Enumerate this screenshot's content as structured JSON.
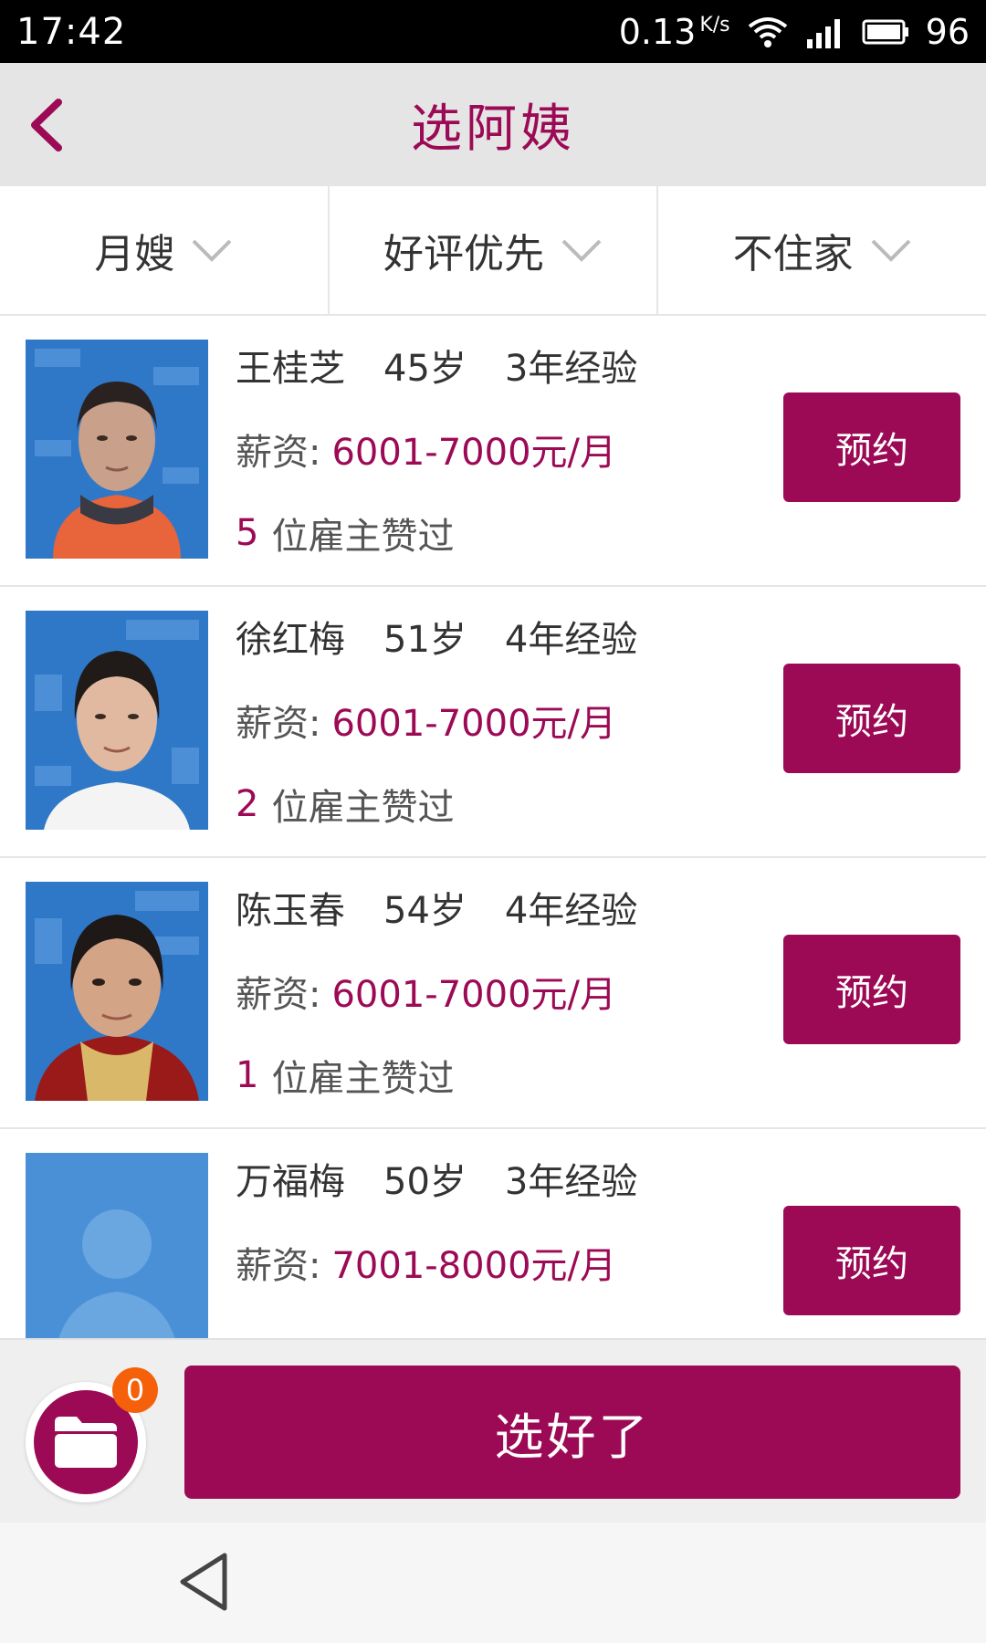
{
  "status_bar": {
    "time": "17:42",
    "speed": "0.13",
    "speed_unit": "K/s",
    "battery": "96",
    "icons": [
      "wifi-icon",
      "signal-icon",
      "battery-icon"
    ]
  },
  "header": {
    "title": "选阿姨",
    "back_icon": "chevron-left-icon",
    "accent_color": "#9c0a55"
  },
  "filters": [
    {
      "label": "月嫂",
      "icon": "chevron-down-icon"
    },
    {
      "label": "好评优先",
      "icon": "chevron-down-icon"
    },
    {
      "label": "不住家",
      "icon": "chevron-down-icon"
    }
  ],
  "nannies": [
    {
      "name": "王桂芝",
      "age": "45岁",
      "experience": "3年经验",
      "salary_label": "薪资:",
      "salary": "6001-7000元/月",
      "likes": "5",
      "likes_label": "位雇主赞过",
      "button": "预约"
    },
    {
      "name": "徐红梅",
      "age": "51岁",
      "experience": "4年经验",
      "salary_label": "薪资:",
      "salary": "6001-7000元/月",
      "likes": "2",
      "likes_label": "位雇主赞过",
      "button": "预约"
    },
    {
      "name": "陈玉春",
      "age": "54岁",
      "experience": "4年经验",
      "salary_label": "薪资:",
      "salary": "6001-7000元/月",
      "likes": "1",
      "likes_label": "位雇主赞过",
      "button": "预约"
    },
    {
      "name": "万福梅",
      "age": "50岁",
      "experience": "3年经验",
      "salary_label": "薪资:",
      "salary": "7001-8000元/月",
      "likes": "",
      "likes_label": "",
      "button": "预约"
    }
  ],
  "bottom_bar": {
    "cart_icon": "folder-icon",
    "cart_count": "0",
    "confirm_label": "选好了"
  },
  "nav_bar": {
    "back_icon": "triangle-back-icon"
  }
}
